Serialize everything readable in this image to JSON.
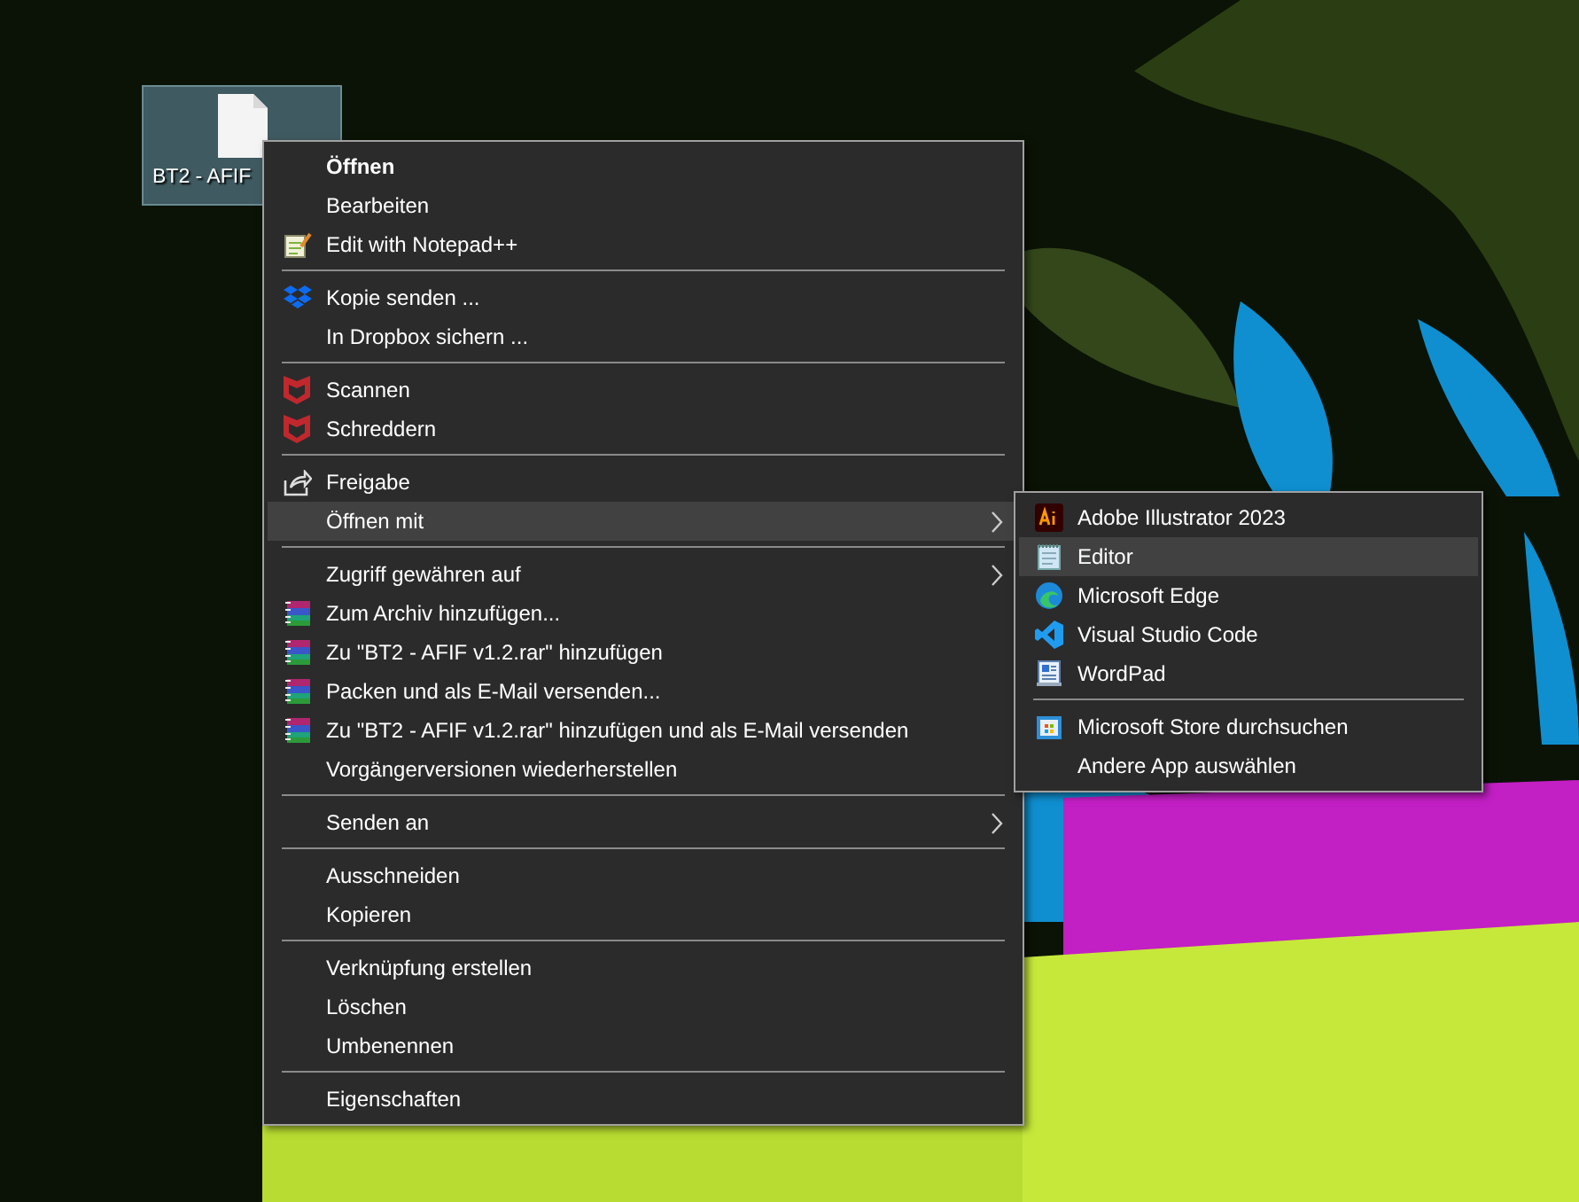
{
  "desktop_icon": {
    "label": "BT2 - AFIF",
    "selected": true
  },
  "context_menu": {
    "groups": [
      [
        {
          "label": "Öffnen",
          "kind": "plain",
          "bold": true,
          "submenu": false,
          "selected": false
        },
        {
          "label": "Bearbeiten",
          "kind": "plain",
          "bold": false,
          "submenu": false,
          "selected": false
        },
        {
          "label": "Edit with Notepad++",
          "kind": "notepadpp",
          "bold": false,
          "submenu": false,
          "selected": false
        }
      ],
      [
        {
          "label": "Kopie senden ...",
          "kind": "dropbox",
          "bold": false,
          "submenu": false,
          "selected": false
        },
        {
          "label": "In Dropbox sichern ...",
          "kind": "plain",
          "bold": false,
          "submenu": false,
          "selected": false
        }
      ],
      [
        {
          "label": "Scannen",
          "kind": "shield",
          "bold": false,
          "submenu": false,
          "selected": false
        },
        {
          "label": "Schreddern",
          "kind": "shield",
          "bold": false,
          "submenu": false,
          "selected": false
        }
      ],
      [
        {
          "label": "Freigabe",
          "kind": "share",
          "bold": false,
          "submenu": false,
          "selected": false
        },
        {
          "label": "Öffnen mit",
          "kind": "plain",
          "bold": false,
          "submenu": true,
          "selected": true
        }
      ],
      [
        {
          "label": "Zugriff gewähren auf",
          "kind": "plain",
          "bold": false,
          "submenu": true,
          "selected": false
        },
        {
          "label": "Zum Archiv hinzufügen...",
          "kind": "archive",
          "bold": false,
          "submenu": false,
          "selected": false
        },
        {
          "label": "Zu \"BT2 - AFIF v1.2.rar\" hinzufügen",
          "kind": "archive",
          "bold": false,
          "submenu": false,
          "selected": false
        },
        {
          "label": "Packen und als E-Mail versenden...",
          "kind": "archive",
          "bold": false,
          "submenu": false,
          "selected": false
        },
        {
          "label": "Zu \"BT2 - AFIF v1.2.rar\" hinzufügen und als E-Mail versenden",
          "kind": "archive",
          "bold": false,
          "submenu": false,
          "selected": false
        },
        {
          "label": "Vorgängerversionen wiederherstellen",
          "kind": "plain",
          "bold": false,
          "submenu": false,
          "selected": false
        }
      ],
      [
        {
          "label": "Senden an",
          "kind": "plain",
          "bold": false,
          "submenu": true,
          "selected": false
        }
      ],
      [
        {
          "label": "Ausschneiden",
          "kind": "plain",
          "bold": false,
          "submenu": false,
          "selected": false
        },
        {
          "label": "Kopieren",
          "kind": "plain",
          "bold": false,
          "submenu": false,
          "selected": false
        }
      ],
      [
        {
          "label": "Verknüpfung erstellen",
          "kind": "plain",
          "bold": false,
          "submenu": false,
          "selected": false
        },
        {
          "label": "Löschen",
          "kind": "plain",
          "bold": false,
          "submenu": false,
          "selected": false
        },
        {
          "label": "Umbenennen",
          "kind": "plain",
          "bold": false,
          "submenu": false,
          "selected": false
        }
      ],
      [
        {
          "label": "Eigenschaften",
          "kind": "plain",
          "bold": false,
          "submenu": false,
          "selected": false
        }
      ]
    ]
  },
  "open_with_submenu": {
    "groups": [
      [
        {
          "label": "Adobe Illustrator 2023",
          "kind": "ai",
          "selected": false
        },
        {
          "label": "Editor",
          "kind": "notepad",
          "selected": true
        },
        {
          "label": "Microsoft Edge",
          "kind": "edge",
          "selected": false
        },
        {
          "label": "Visual Studio Code",
          "kind": "vscode",
          "selected": false
        },
        {
          "label": "WordPad",
          "kind": "wordpad",
          "selected": false
        }
      ],
      [
        {
          "label": "Microsoft Store durchsuchen",
          "kind": "store",
          "selected": false
        },
        {
          "label": "Andere App auswählen",
          "kind": "plain",
          "selected": false
        }
      ]
    ]
  }
}
